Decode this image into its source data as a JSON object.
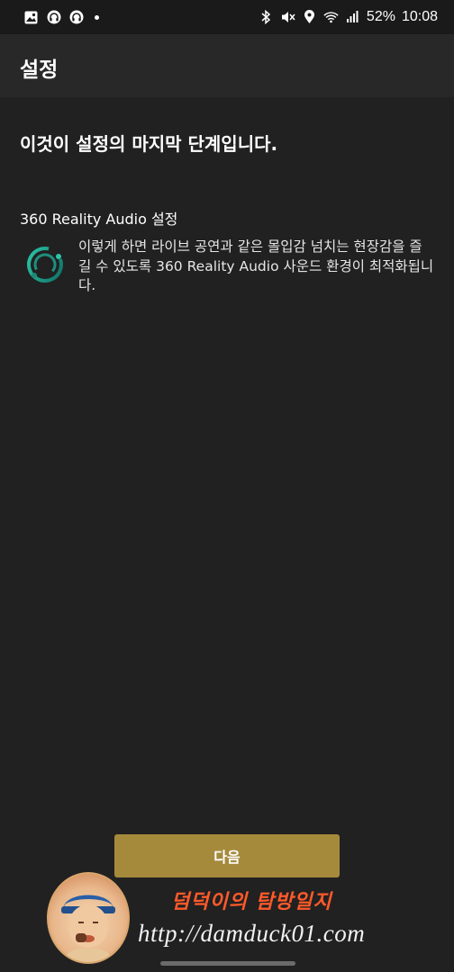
{
  "status_bar": {
    "battery": "52%",
    "time": "10:08",
    "left_icons": [
      "gallery-icon",
      "headset-icon",
      "headset-icon",
      "dot-icon"
    ],
    "right_icons": [
      "bluetooth-icon",
      "mute-icon",
      "location-icon",
      "wifi-icon",
      "signal-icon"
    ]
  },
  "app_bar": {
    "title": "설정"
  },
  "main": {
    "heading": "이것이 설정의 마지막 단계입니다.",
    "section_title": "360 Reality Audio 설정",
    "description": "이렇게 하면 라이브 공연과 같은 몰입감 넘치는 현장감을 즐길 수 있도록 360 Reality Audio 사운드 환경이 최적화됩니다.",
    "logo_icon": "360-reality-audio-icon"
  },
  "footer": {
    "next_label": "다음"
  },
  "watermark": {
    "title": "덤덕이의 탐방일지",
    "url": "http://damduck01.com"
  },
  "colors": {
    "background": "#212121",
    "app_bar": "#282828",
    "button": "#a68a3c",
    "logo_teal": "#1fa58f",
    "watermark_title": "#ff5a2a"
  }
}
